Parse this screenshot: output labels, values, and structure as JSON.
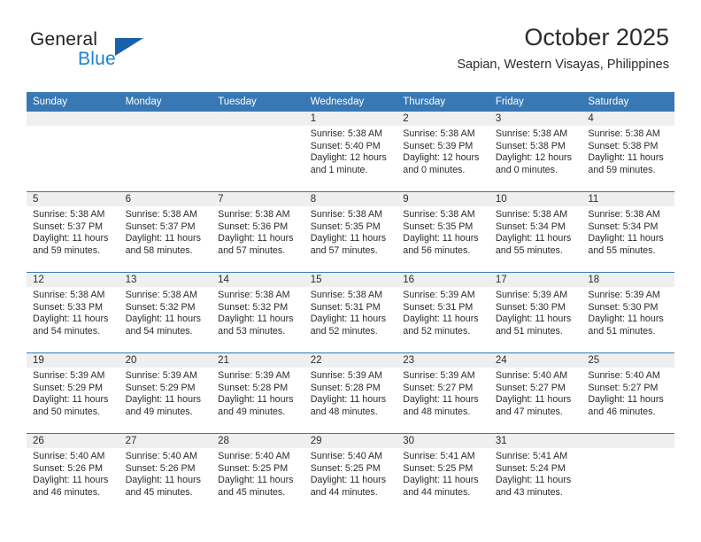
{
  "brand": {
    "name_top": "General",
    "name_bottom": "Blue",
    "flag_icon": "brand-flag-icon",
    "accent_color": "#1a5fa8",
    "blue_text_color": "#1f7fd0"
  },
  "header": {
    "title": "October 2025",
    "subtitle": "Sapian, Western Visayas, Philippines"
  },
  "calendar": {
    "header_background": "#3878b4",
    "daynum_background": "#efefef",
    "weekdays": [
      "Sunday",
      "Monday",
      "Tuesday",
      "Wednesday",
      "Thursday",
      "Friday",
      "Saturday"
    ],
    "weeks": [
      [
        {
          "day": "",
          "empty": true
        },
        {
          "day": "",
          "empty": true
        },
        {
          "day": "",
          "empty": true
        },
        {
          "day": "1",
          "sunrise": "Sunrise: 5:38 AM",
          "sunset": "Sunset: 5:40 PM",
          "daylight": "Daylight: 12 hours and 1 minute."
        },
        {
          "day": "2",
          "sunrise": "Sunrise: 5:38 AM",
          "sunset": "Sunset: 5:39 PM",
          "daylight": "Daylight: 12 hours and 0 minutes."
        },
        {
          "day": "3",
          "sunrise": "Sunrise: 5:38 AM",
          "sunset": "Sunset: 5:38 PM",
          "daylight": "Daylight: 12 hours and 0 minutes."
        },
        {
          "day": "4",
          "sunrise": "Sunrise: 5:38 AM",
          "sunset": "Sunset: 5:38 PM",
          "daylight": "Daylight: 11 hours and 59 minutes."
        }
      ],
      [
        {
          "day": "5",
          "sunrise": "Sunrise: 5:38 AM",
          "sunset": "Sunset: 5:37 PM",
          "daylight": "Daylight: 11 hours and 59 minutes."
        },
        {
          "day": "6",
          "sunrise": "Sunrise: 5:38 AM",
          "sunset": "Sunset: 5:37 PM",
          "daylight": "Daylight: 11 hours and 58 minutes."
        },
        {
          "day": "7",
          "sunrise": "Sunrise: 5:38 AM",
          "sunset": "Sunset: 5:36 PM",
          "daylight": "Daylight: 11 hours and 57 minutes."
        },
        {
          "day": "8",
          "sunrise": "Sunrise: 5:38 AM",
          "sunset": "Sunset: 5:35 PM",
          "daylight": "Daylight: 11 hours and 57 minutes."
        },
        {
          "day": "9",
          "sunrise": "Sunrise: 5:38 AM",
          "sunset": "Sunset: 5:35 PM",
          "daylight": "Daylight: 11 hours and 56 minutes."
        },
        {
          "day": "10",
          "sunrise": "Sunrise: 5:38 AM",
          "sunset": "Sunset: 5:34 PM",
          "daylight": "Daylight: 11 hours and 55 minutes."
        },
        {
          "day": "11",
          "sunrise": "Sunrise: 5:38 AM",
          "sunset": "Sunset: 5:34 PM",
          "daylight": "Daylight: 11 hours and 55 minutes."
        }
      ],
      [
        {
          "day": "12",
          "sunrise": "Sunrise: 5:38 AM",
          "sunset": "Sunset: 5:33 PM",
          "daylight": "Daylight: 11 hours and 54 minutes."
        },
        {
          "day": "13",
          "sunrise": "Sunrise: 5:38 AM",
          "sunset": "Sunset: 5:32 PM",
          "daylight": "Daylight: 11 hours and 54 minutes."
        },
        {
          "day": "14",
          "sunrise": "Sunrise: 5:38 AM",
          "sunset": "Sunset: 5:32 PM",
          "daylight": "Daylight: 11 hours and 53 minutes."
        },
        {
          "day": "15",
          "sunrise": "Sunrise: 5:38 AM",
          "sunset": "Sunset: 5:31 PM",
          "daylight": "Daylight: 11 hours and 52 minutes."
        },
        {
          "day": "16",
          "sunrise": "Sunrise: 5:39 AM",
          "sunset": "Sunset: 5:31 PM",
          "daylight": "Daylight: 11 hours and 52 minutes."
        },
        {
          "day": "17",
          "sunrise": "Sunrise: 5:39 AM",
          "sunset": "Sunset: 5:30 PM",
          "daylight": "Daylight: 11 hours and 51 minutes."
        },
        {
          "day": "18",
          "sunrise": "Sunrise: 5:39 AM",
          "sunset": "Sunset: 5:30 PM",
          "daylight": "Daylight: 11 hours and 51 minutes."
        }
      ],
      [
        {
          "day": "19",
          "sunrise": "Sunrise: 5:39 AM",
          "sunset": "Sunset: 5:29 PM",
          "daylight": "Daylight: 11 hours and 50 minutes."
        },
        {
          "day": "20",
          "sunrise": "Sunrise: 5:39 AM",
          "sunset": "Sunset: 5:29 PM",
          "daylight": "Daylight: 11 hours and 49 minutes."
        },
        {
          "day": "21",
          "sunrise": "Sunrise: 5:39 AM",
          "sunset": "Sunset: 5:28 PM",
          "daylight": "Daylight: 11 hours and 49 minutes."
        },
        {
          "day": "22",
          "sunrise": "Sunrise: 5:39 AM",
          "sunset": "Sunset: 5:28 PM",
          "daylight": "Daylight: 11 hours and 48 minutes."
        },
        {
          "day": "23",
          "sunrise": "Sunrise: 5:39 AM",
          "sunset": "Sunset: 5:27 PM",
          "daylight": "Daylight: 11 hours and 48 minutes."
        },
        {
          "day": "24",
          "sunrise": "Sunrise: 5:40 AM",
          "sunset": "Sunset: 5:27 PM",
          "daylight": "Daylight: 11 hours and 47 minutes."
        },
        {
          "day": "25",
          "sunrise": "Sunrise: 5:40 AM",
          "sunset": "Sunset: 5:27 PM",
          "daylight": "Daylight: 11 hours and 46 minutes."
        }
      ],
      [
        {
          "day": "26",
          "sunrise": "Sunrise: 5:40 AM",
          "sunset": "Sunset: 5:26 PM",
          "daylight": "Daylight: 11 hours and 46 minutes."
        },
        {
          "day": "27",
          "sunrise": "Sunrise: 5:40 AM",
          "sunset": "Sunset: 5:26 PM",
          "daylight": "Daylight: 11 hours and 45 minutes."
        },
        {
          "day": "28",
          "sunrise": "Sunrise: 5:40 AM",
          "sunset": "Sunset: 5:25 PM",
          "daylight": "Daylight: 11 hours and 45 minutes."
        },
        {
          "day": "29",
          "sunrise": "Sunrise: 5:40 AM",
          "sunset": "Sunset: 5:25 PM",
          "daylight": "Daylight: 11 hours and 44 minutes."
        },
        {
          "day": "30",
          "sunrise": "Sunrise: 5:41 AM",
          "sunset": "Sunset: 5:25 PM",
          "daylight": "Daylight: 11 hours and 44 minutes."
        },
        {
          "day": "31",
          "sunrise": "Sunrise: 5:41 AM",
          "sunset": "Sunset: 5:24 PM",
          "daylight": "Daylight: 11 hours and 43 minutes."
        },
        {
          "day": "",
          "empty": true
        }
      ]
    ]
  }
}
